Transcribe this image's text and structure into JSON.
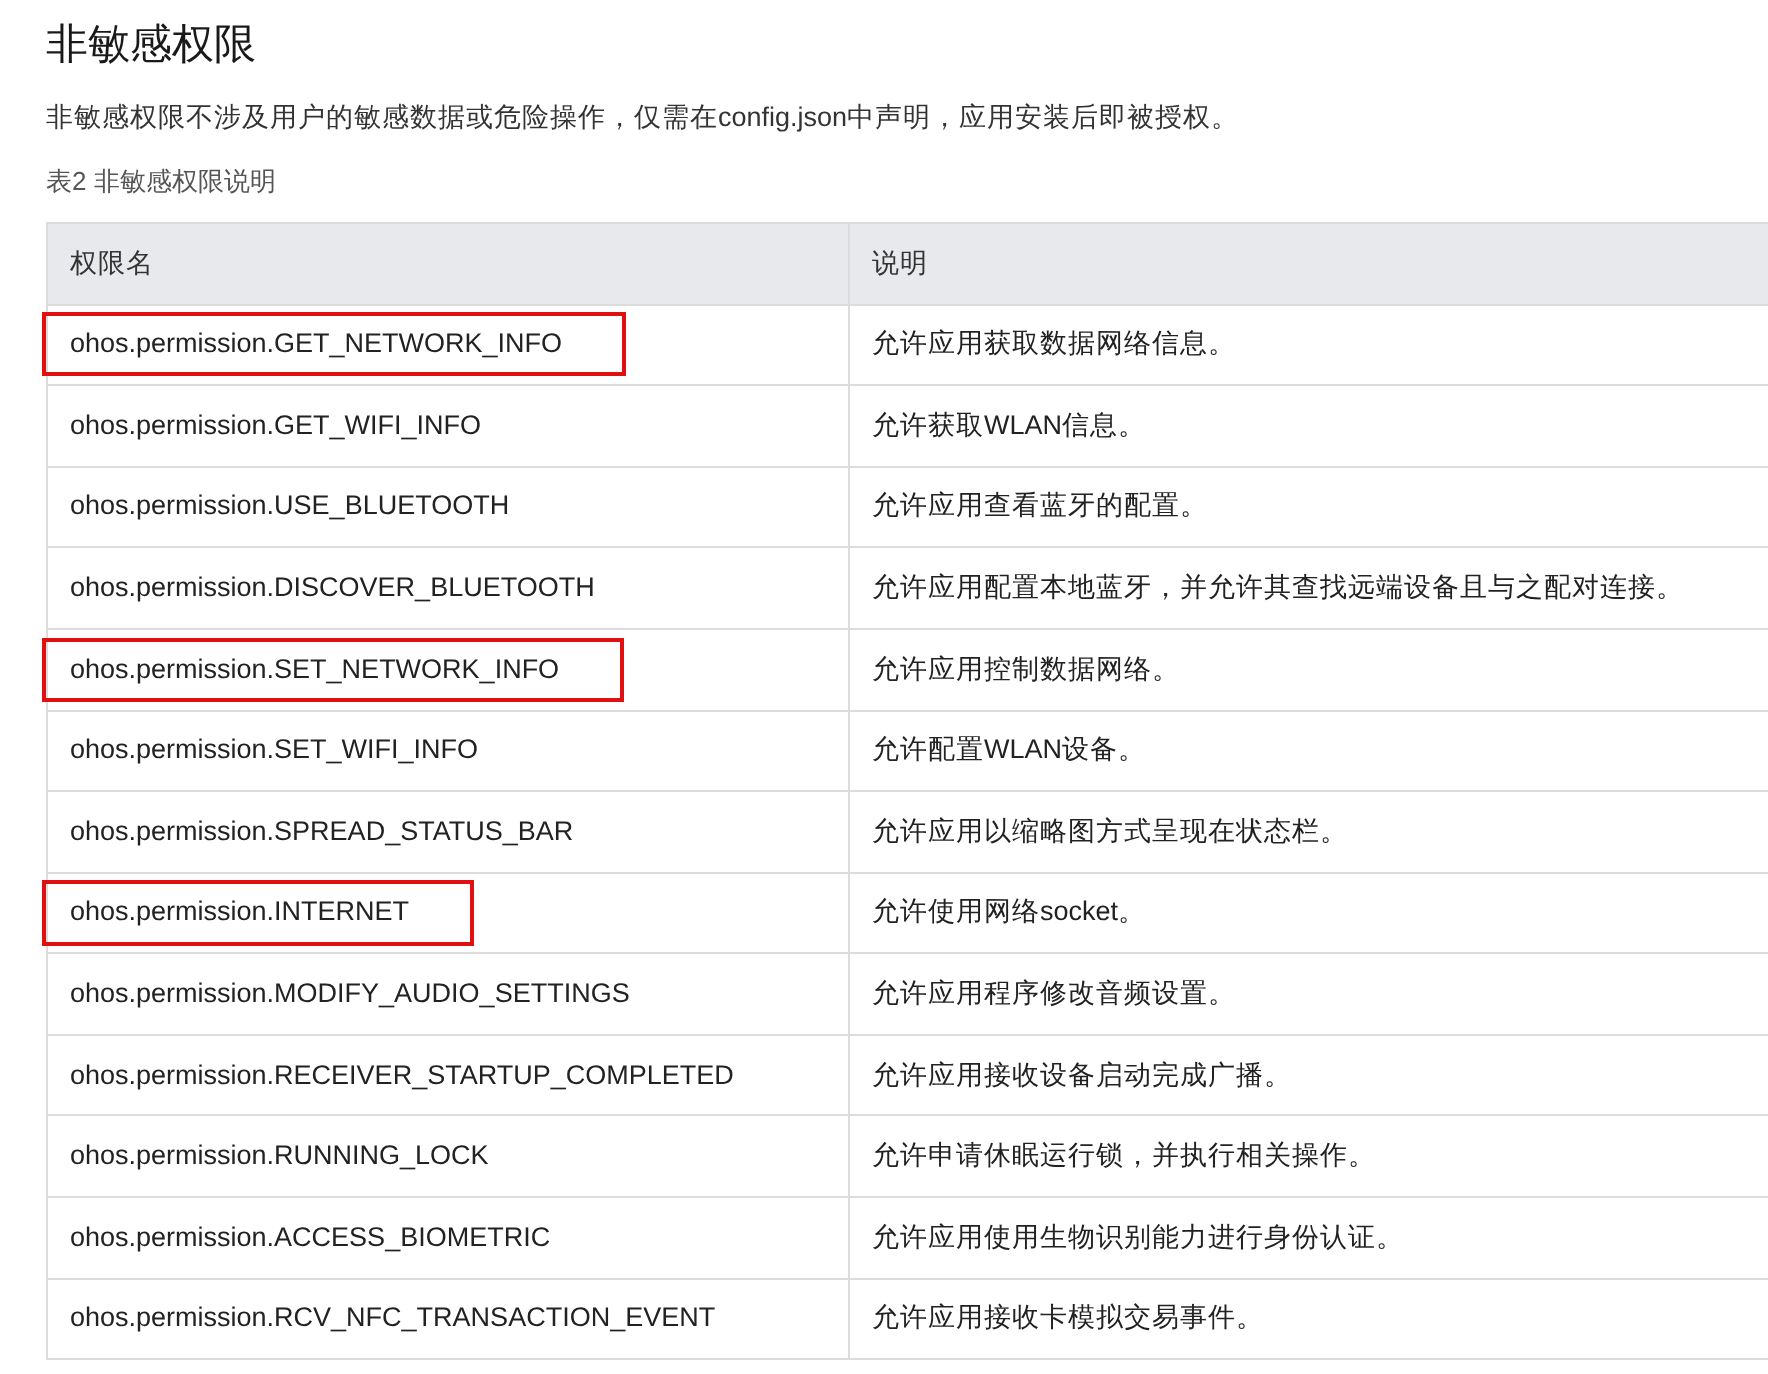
{
  "title": "非敏感权限",
  "intro": "非敏感权限不涉及用户的敏感数据或危险操作，仅需在config.json中声明，应用安装后即被授权。",
  "caption": "表2 非敏感权限说明",
  "table": {
    "columns": [
      "权限名",
      "说明"
    ],
    "rows": [
      {
        "name": "ohos.permission.GET_NETWORK_INFO",
        "description": "允许应用获取数据网络信息。",
        "highlighted": true
      },
      {
        "name": "ohos.permission.GET_WIFI_INFO",
        "description": "允许获取WLAN信息。",
        "highlighted": false
      },
      {
        "name": "ohos.permission.USE_BLUETOOTH",
        "description": "允许应用查看蓝牙的配置。",
        "highlighted": false
      },
      {
        "name": "ohos.permission.DISCOVER_BLUETOOTH",
        "description": "允许应用配置本地蓝牙，并允许其查找远端设备且与之配对连接。",
        "highlighted": false
      },
      {
        "name": "ohos.permission.SET_NETWORK_INFO",
        "description": "允许应用控制数据网络。",
        "highlighted": true
      },
      {
        "name": "ohos.permission.SET_WIFI_INFO",
        "description": "允许配置WLAN设备。",
        "highlighted": false
      },
      {
        "name": "ohos.permission.SPREAD_STATUS_BAR",
        "description": "允许应用以缩略图方式呈现在状态栏。",
        "highlighted": false
      },
      {
        "name": "ohos.permission.INTERNET",
        "description": "允许使用网络socket。",
        "highlighted": true
      },
      {
        "name": "ohos.permission.MODIFY_AUDIO_SETTINGS",
        "description": "允许应用程序修改音频设置。",
        "highlighted": false
      },
      {
        "name": "ohos.permission.RECEIVER_STARTUP_COMPLETED",
        "description": "允许应用接收设备启动完成广播。",
        "highlighted": false
      },
      {
        "name": "ohos.permission.RUNNING_LOCK",
        "description": "允许申请休眠运行锁，并执行相关操作。",
        "highlighted": false
      },
      {
        "name": "ohos.permission.ACCESS_BIOMETRIC",
        "description": "允许应用使用生物识别能力进行身份认证。",
        "highlighted": false
      },
      {
        "name": "ohos.permission.RCV_NFC_TRANSACTION_EVENT",
        "description": "允许应用接收卡模拟交易事件。",
        "highlighted": false
      }
    ]
  }
}
